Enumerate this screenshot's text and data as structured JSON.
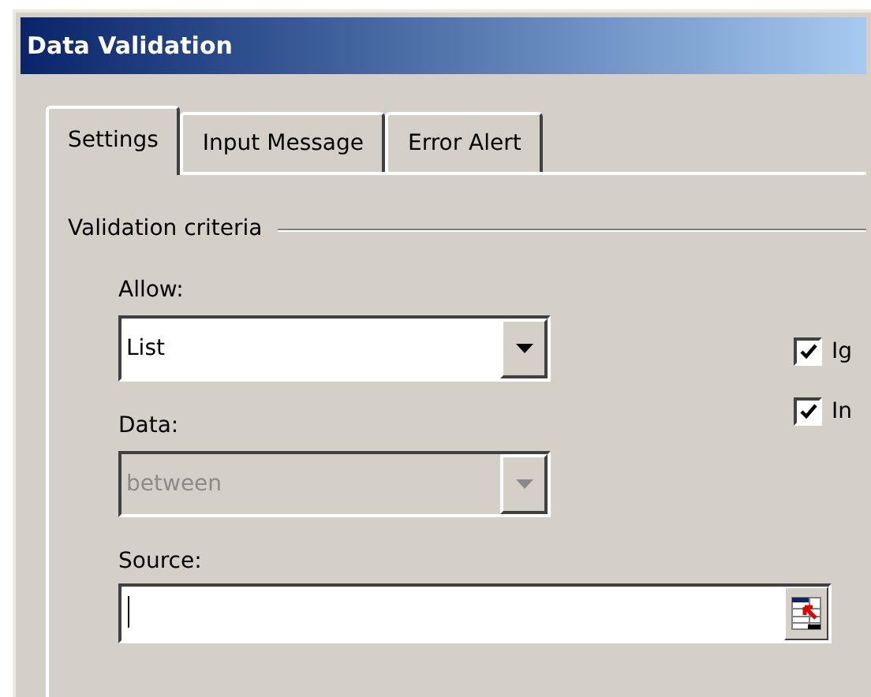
{
  "window": {
    "title": "Data Validation"
  },
  "tabs": [
    {
      "label": "Settings",
      "selected": true
    },
    {
      "label": "Input Message",
      "selected": false
    },
    {
      "label": "Error Alert",
      "selected": false
    }
  ],
  "group": {
    "title": "Validation criteria"
  },
  "allow": {
    "label": "Allow:",
    "value": "List",
    "disabled": false
  },
  "data": {
    "label": "Data:",
    "value": "between",
    "disabled": true
  },
  "checkboxes": [
    {
      "label": "Ig",
      "checked": true
    },
    {
      "label": "In",
      "checked": true
    }
  ],
  "source": {
    "label": "Source:"
  }
}
